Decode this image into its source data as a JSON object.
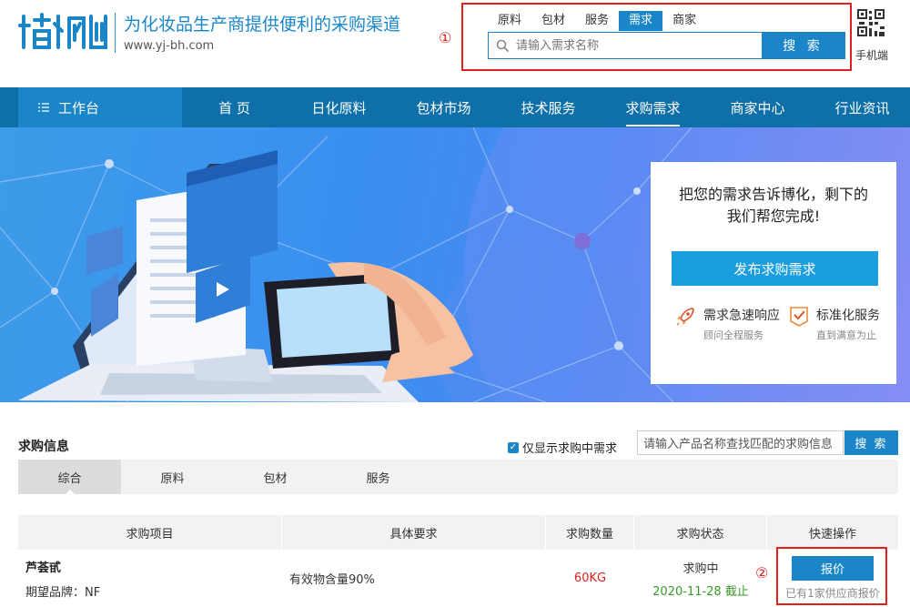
{
  "header": {
    "slogan": "为化妆品生产商提供便利的采购渠道",
    "site_url": "www.yj-bh.com",
    "annotation_1": "①",
    "category_tabs": [
      {
        "label": "原料",
        "active": false
      },
      {
        "label": "包材",
        "active": false
      },
      {
        "label": "服务",
        "active": false
      },
      {
        "label": "需求",
        "active": true
      },
      {
        "label": "商家",
        "active": false
      }
    ],
    "search_placeholder": "请输入需求名称",
    "search_button": "搜 索",
    "mobile_label": "手机端"
  },
  "nav": {
    "workbench": "工作台",
    "items": [
      {
        "label": "首 页",
        "active": false
      },
      {
        "label": "日化原料",
        "active": false
      },
      {
        "label": "包材市场",
        "active": false
      },
      {
        "label": "技术服务",
        "active": false
      },
      {
        "label": "求购需求",
        "active": true
      },
      {
        "label": "商家中心",
        "active": false
      },
      {
        "label": "行业资讯",
        "active": false
      }
    ]
  },
  "banner_card": {
    "line1": "把您的需求告诉博化，剩下的",
    "line2": "我们帮您完成!",
    "publish_button": "发布求购需求",
    "features": [
      {
        "title": "需求急速响应",
        "sub": "顾问全程服务",
        "icon": "rocket-icon"
      },
      {
        "title": "标准化服务",
        "sub": "直到满意为止",
        "icon": "checkmark-badge-icon"
      }
    ]
  },
  "purchase_info": {
    "title": "求购信息",
    "checkbox_label": "仅显示求购中需求",
    "checkbox_checked": true,
    "search_placeholder": "请输入产品名称查找匹配的求购信息",
    "search_button": "搜 索",
    "tabs": [
      {
        "label": "综合",
        "active": true
      },
      {
        "label": "原料",
        "active": false
      },
      {
        "label": "包材",
        "active": false
      },
      {
        "label": "服务",
        "active": false
      }
    ]
  },
  "table": {
    "headers": [
      "求购项目",
      "具体要求",
      "求购数量",
      "求购状态",
      "快速操作"
    ],
    "rows": [
      {
        "name": "芦荟甙",
        "brand": "期望品牌：NF",
        "requirement": "有效物含量90%",
        "quantity": "60KG",
        "status": "求购中",
        "deadline": "2020-11-28 截止",
        "action": "报价",
        "note": "已有1家供应商报价"
      }
    ],
    "annotation_2": "②"
  },
  "colors": {
    "primary": "#1a86c8",
    "nav_bg": "#0f6fa8",
    "annotation": "#e02020",
    "quantity": "#e02020",
    "deadline": "#3a9a2a"
  }
}
